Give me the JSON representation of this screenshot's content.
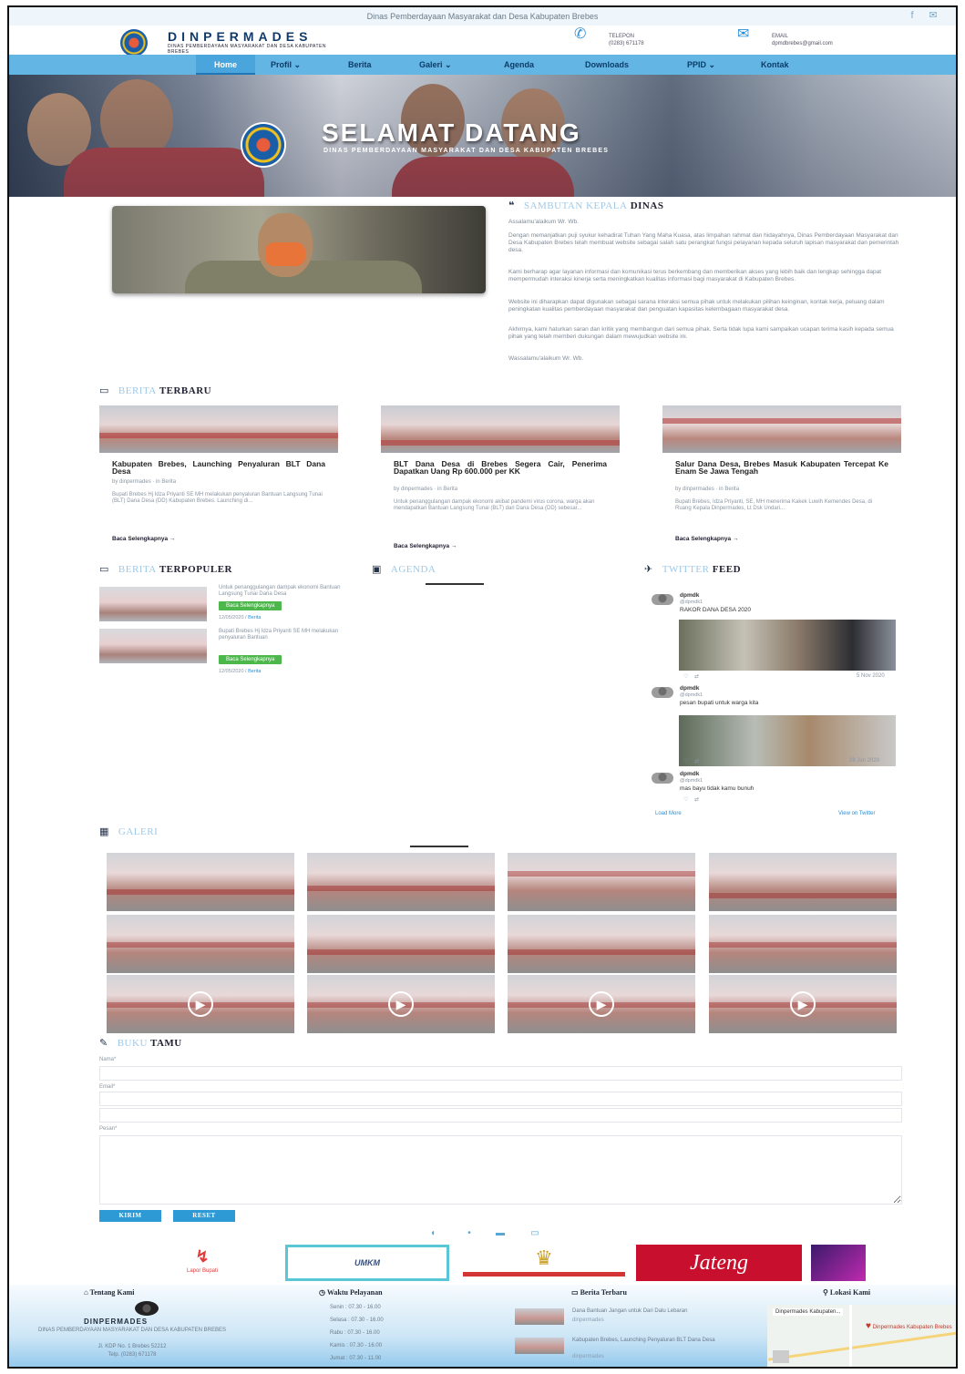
{
  "topbar": {
    "text": "Dinas Pemberdayaan Masyarakat dan Desa Kabupaten Brebes"
  },
  "header": {
    "brand": "DINPERMADES",
    "brand_sub": "DINAS PEMBERDAYAAN MASYARAKAT DAN DESA KABUPATEN BREBES",
    "phone_label": "TELEPON",
    "phone_value": "(0283) 671178",
    "email_label": "EMAIL",
    "email_value": "dpmdbrebes@gmail.com"
  },
  "nav": [
    {
      "label": "Home"
    },
    {
      "label": "Profil ⌄"
    },
    {
      "label": "Berita"
    },
    {
      "label": "Galeri ⌄"
    },
    {
      "label": "Agenda"
    },
    {
      "label": "Downloads"
    },
    {
      "label": "PPID ⌄"
    },
    {
      "label": "Kontak"
    }
  ],
  "hero": {
    "title": "SELAMAT DATANG",
    "subtitle": "DINAS PEMBERDAYAAN MASYARAKAT DAN DESA KABUPATEN BREBES"
  },
  "welcome": {
    "title_hl": "SAMBUTAN KEPALA",
    "title_rest": "DINAS",
    "greeting": "Assalamu'alaikum Wr. Wb.",
    "p1": "Dengan memanjatkan puji syukur kehadirat Tuhan Yang Maha Kuasa, atas limpahan rahmat dan hidayahnya, Dinas Pemberdayaan Masyarakat dan Desa Kabupaten Brebes telah membuat website sebagai salah satu perangkat fungsi pelayanan kepada seluruh lapisan masyarakat dan pemerintah desa.",
    "p2": "Kami berharap agar layanan informasi dan komunikasi terus berkembang dan memberikan akses yang lebih baik dan lengkap sehingga dapat mempermudah interaksi kinerja serta meningkatkan kualitas informasi bagi masyarakat di Kabupaten Brebes.",
    "p3": "Website ini diharapkan dapat digunakan sebagai sarana interaksi semua pihak untuk melakukan pilihan keinginan, kontak kerja, peluang dalam peningkatan kualitas pemberdayaan masyarakat dan penguatan kapasitas kelembagaan masyarakat desa.",
    "p4": "Akhirnya, kami haturkan saran dan kritik yang membangun dari semua pihak. Serta tidak lupa kami sampaikan ucapan terima kasih kepada semua pihak yang telah memberi dukungan dalam mewujudkan website ini.",
    "closing": "Wassalamu'alaikum Wr. Wb."
  },
  "berita": {
    "title_hl": "BERITA",
    "title_rest": "TERBARU",
    "read_more": "Baca Selengkapnya →",
    "items": [
      {
        "title": "Kabupaten Brebes, Launching Penyaluran BLT Dana Desa",
        "meta": "by dinpermades · in Berita",
        "excerpt": "Bupati Brebes Hj Idza Priyanti SE MH melakukan penyaluran Bantuan Langsung Tunai (BLT) Dana Desa (DD) Kabupaten Brebes. Launching di..."
      },
      {
        "title": "BLT Dana Desa di Brebes Segera Cair, Penerima Dapatkan Uang Rp 600.000 per KK",
        "meta": "by dinpermades · in Berita",
        "excerpt": "Untuk penanggulangan dampak ekonomi akibat pandemi virus corona, warga akan mendapatkan Bantuan Langsung Tunai (BLT) dari Dana Desa (DD) sebesar..."
      },
      {
        "title": "Salur Dana Desa, Brebes Masuk Kabupaten Tercepat Ke Enam Se Jawa Tengah",
        "meta": "by dinpermades · in Berita",
        "excerpt": "Bupati Brebes, Idza Priyanti, SE, MH menerima Kakek Luwih Kemendes Desa, di Ruang Kepala Dinpermades, Lt Dsk Undari..."
      }
    ]
  },
  "populer": {
    "title_hl": "BERITA",
    "title_rest": "TERPOPULER",
    "button": "Baca Selengkapnya",
    "items": [
      {
        "text": "Untuk penanggulangan dampak ekonomi Bantuan Langsung Tunai Dana Desa",
        "date": "12/05/2020",
        "cat": "Berita"
      },
      {
        "text": "Bupati Brebes Hj Idza Priyanti SE MH melakukan penyaluran Bantuan",
        "date": "12/05/2020",
        "cat": "Berita"
      }
    ]
  },
  "agenda": {
    "title": "AGENDA"
  },
  "twitter": {
    "title_hl": "TWITTER",
    "title_rest": "FEED",
    "tweets": [
      {
        "name": "dpmdk",
        "handle": "@dpmdk1",
        "text": "RAKOR DANA DESA 2020",
        "date": "5 Nov 2020"
      },
      {
        "name": "dpmdk",
        "handle": "@dpmdk1",
        "text": "pesan bupati untuk warga kita",
        "date": "28 Jun 2020"
      },
      {
        "name": "dpmdk",
        "handle": "@dpmdk1",
        "text": "mas bayu tidak kamu bunuh",
        "date": ""
      }
    ],
    "load_more": "Load More",
    "view_on": "View on Twitter"
  },
  "galeri": {
    "title": "GALERI"
  },
  "bukutamu": {
    "title_hl": "BUKU",
    "title_rest": "TAMU",
    "name_label": "Nama*",
    "email_label": "Email*",
    "message_label": "Pesan*",
    "kirim": "KIRIM",
    "reset": "RESET"
  },
  "partners": {
    "p1": "Lapor Bupati",
    "p2": "UMKM",
    "p4": "Jateng"
  },
  "footer": {
    "about_title": "Tentang Kami",
    "about_brand": "DINPERMADES",
    "about_text": "DINAS PEMBERDAYAAN MASYARAKAT DAN DESA KABUPATEN BREBES",
    "about_addr": "Jl. KDP No. 1 Brebes 52212",
    "about_tel": "Telp. (0283) 671178",
    "hours_title": "Waktu Pelayanan",
    "hours": [
      "Senin : 07.30 - 16.00",
      "Selasa : 07.30 - 16.00",
      "Rabu : 07.30 - 16.00",
      "Kamis : 07.30 - 16.00",
      "Jumat : 07.30 - 11.00"
    ],
    "news_title": "Berita Terbaru",
    "news1": "Dana Bantuan Jangan untuk Dari Dalu Lebaran",
    "news1_meta": "dinpermades",
    "news2": "Kabupaten Brebes, Launching Penyaluran BLT Dana Desa",
    "news2_meta": "dinpermades",
    "loc_title": "Lokasi Kami",
    "map_title": "Dinpermades Kabupaten...",
    "map_pin": "Dinpermades Kabupaten Brebes"
  },
  "colors": {
    "nav": "#63b5e3",
    "accent": "#2d9ad6",
    "green": "#4cb84c"
  }
}
